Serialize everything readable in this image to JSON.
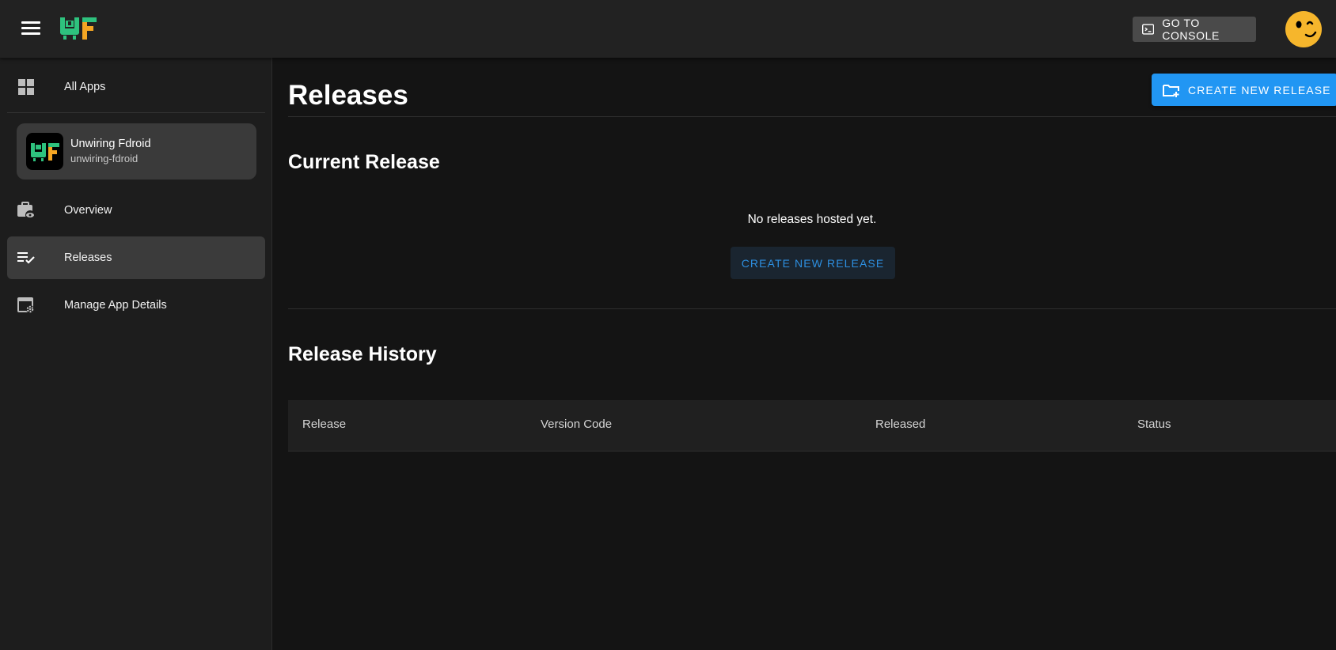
{
  "topbar": {
    "console_label": "GO TO CONSOLE"
  },
  "sidebar": {
    "all_apps_label": "All Apps",
    "app": {
      "name": "Unwiring Fdroid",
      "slug": "unwiring-fdroid"
    },
    "items": [
      {
        "label": "Overview",
        "icon": "briefcase-eye-icon"
      },
      {
        "label": "Releases",
        "icon": "playlist-check-icon",
        "active": true
      },
      {
        "label": "Manage App Details",
        "icon": "window-gear-icon"
      }
    ]
  },
  "main": {
    "title": "Releases",
    "create_button_label": "CREATE NEW RELEASE",
    "current_release": {
      "title": "Current Release",
      "empty_text": "No releases hosted yet.",
      "create_button_label": "CREATE NEW RELEASE"
    },
    "history": {
      "title": "Release History",
      "columns": [
        "Release",
        "Version Code",
        "Released",
        "Status"
      ]
    }
  },
  "colors": {
    "accent": "#2196f3",
    "logo_green": "#2ec27e",
    "logo_orange": "#f5a623",
    "avatar": "#f6b62c"
  }
}
